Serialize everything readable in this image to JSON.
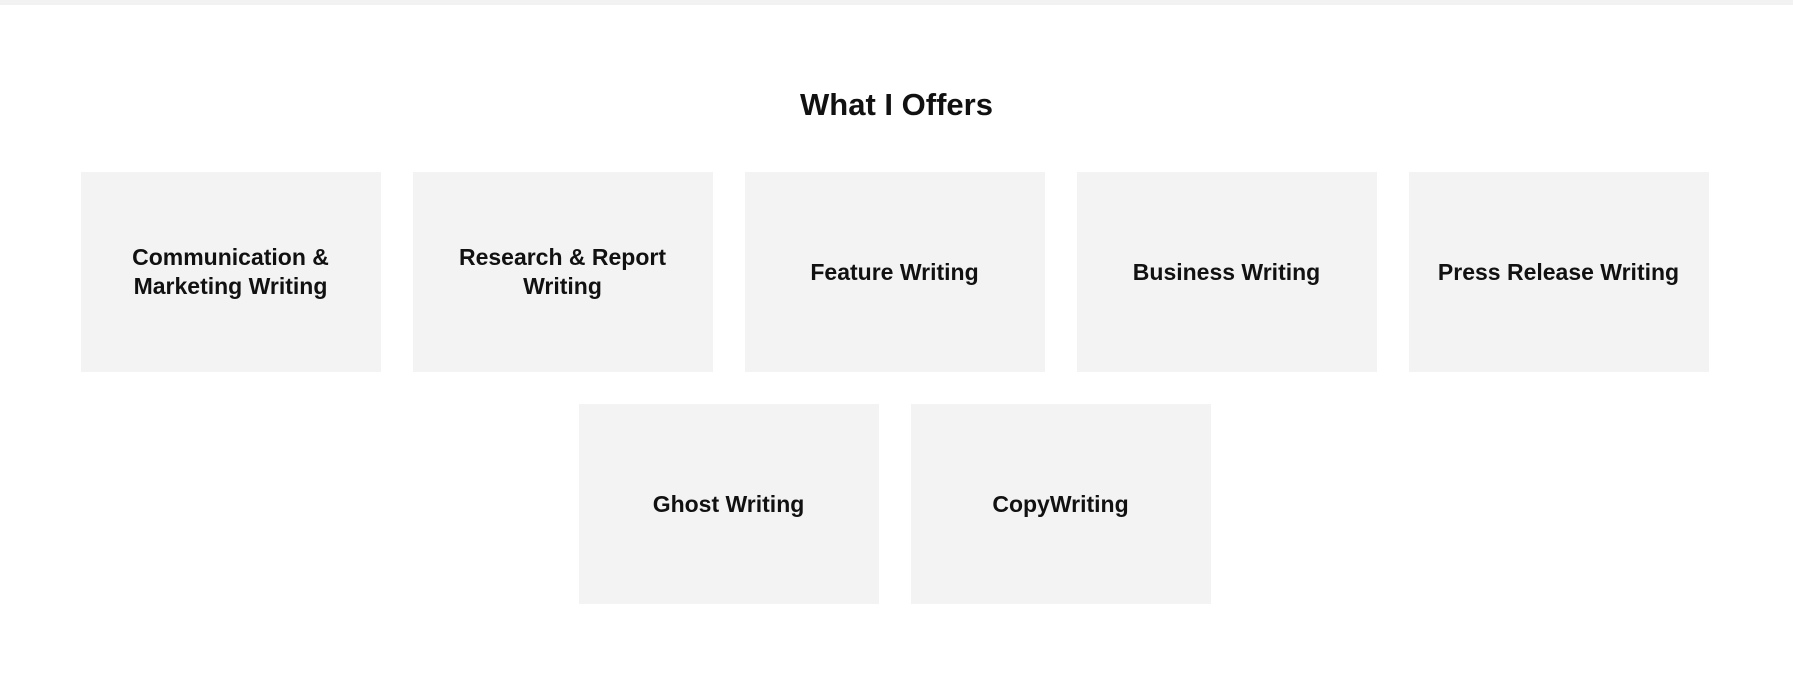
{
  "section": {
    "title": "What I Offers"
  },
  "offers": {
    "row1": [
      {
        "label": "Communication & Marketing Writing"
      },
      {
        "label": "Research & Report Writing"
      },
      {
        "label": "Feature Writing"
      },
      {
        "label": "Business Writing"
      },
      {
        "label": "Press Release Writing"
      }
    ],
    "row2": [
      {
        "label": "Ghost Writing"
      },
      {
        "label": "CopyWriting"
      }
    ]
  },
  "colors": {
    "card_background": "#f3f3f3",
    "text": "#111111",
    "page_background": "#ffffff"
  }
}
